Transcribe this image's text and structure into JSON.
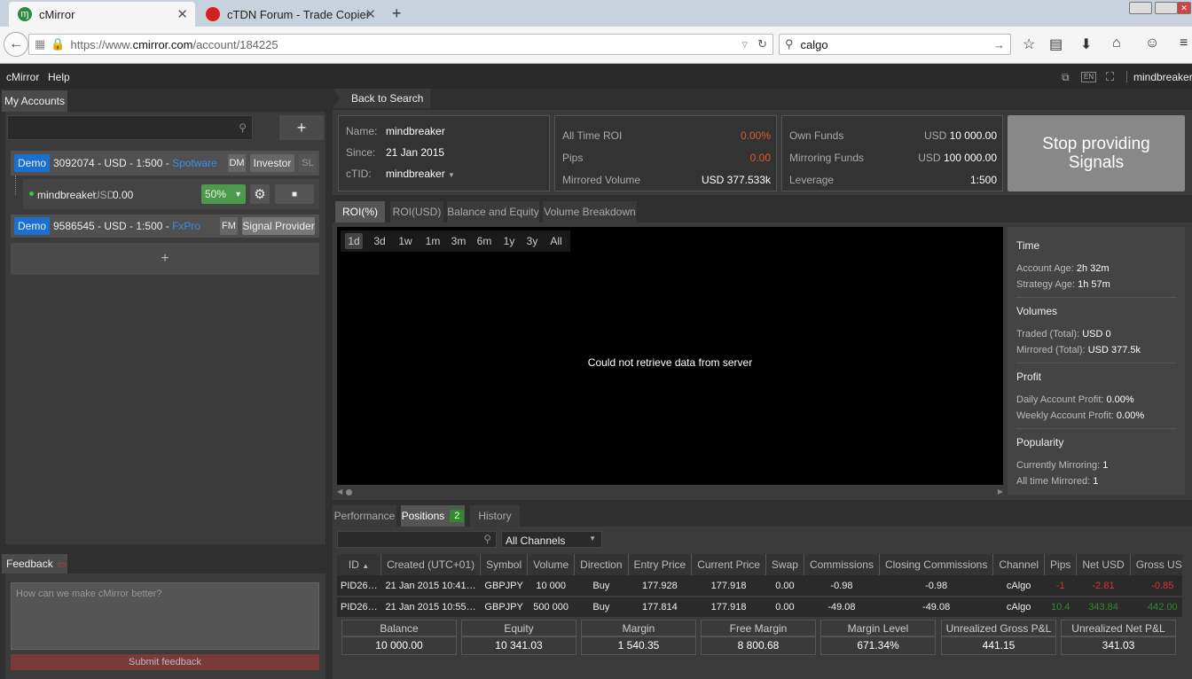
{
  "browser": {
    "tabs": [
      {
        "title": "cMirror",
        "active": true
      },
      {
        "title": "cTDN Forum - Trade Copier",
        "active": false
      }
    ],
    "url_prefix": "https://www.",
    "url_domain": "cmirror.com",
    "url_path": "/account/184225",
    "search_value": "calgo"
  },
  "app": {
    "menu": [
      "cMirror",
      "Help"
    ],
    "lang": "EN",
    "username": "mindbreaker",
    "colors": {
      "accent_blue": "#1a6fd1",
      "positive": "#2e8b2e",
      "negative": "#e03030",
      "green_btn": "#4c9a4c"
    }
  },
  "sidebar": {
    "tab": "My Accounts",
    "search_placeholder": "",
    "add_label": "+",
    "accounts": [
      {
        "badge": "Demo",
        "text": "3092074 - USD - 1:500 - ",
        "broker": "Spotware",
        "buttons": [
          "DM",
          "Investor",
          "SL"
        ]
      },
      {
        "badge": "Demo",
        "text": "9586545 - USD - 1:500 - ",
        "broker": "FxPro",
        "buttons": [
          "FM",
          "Signal Provider"
        ]
      }
    ],
    "sub_account": {
      "name": "mindbreaker",
      "currency": "USD",
      "value": "0.00",
      "percent": "50%"
    },
    "add_account_label": "+"
  },
  "feedback": {
    "tab": "Feedback",
    "placeholder": "How can we make cMirror better?",
    "submit": "Submit feedback"
  },
  "header": {
    "back": "Back to Search",
    "info": [
      {
        "label": "Name:",
        "value": "mindbreaker"
      },
      {
        "label": "Since:",
        "value": "21 Jan 2015"
      },
      {
        "label": "cTID:",
        "value": "mindbreaker"
      }
    ],
    "stats1": [
      {
        "label": "All Time ROI",
        "value": "0.00%",
        "color": "#e05a2b"
      },
      {
        "label": "Pips",
        "value": "0.00",
        "color": "#e05a2b"
      },
      {
        "label": "Mirrored Volume",
        "value": "USD 377.533k",
        "color": "#ffffff"
      }
    ],
    "stats2": [
      {
        "label": "Own Funds",
        "prefix": "USD ",
        "value": "10 000.00"
      },
      {
        "label": "Mirroring Funds",
        "prefix": "USD ",
        "value": "100 000.00"
      },
      {
        "label": "Leverage",
        "prefix": "",
        "value": "1:500"
      }
    ],
    "stop_button": "Stop providing Signals"
  },
  "chart_tabs": [
    "ROI(%)",
    "ROI(USD)",
    "Balance and Equity",
    "Volume Breakdown"
  ],
  "periods": [
    "1d",
    "3d",
    "1w",
    "1m",
    "3m",
    "6m",
    "1y",
    "3y",
    "All"
  ],
  "chart_message": "Could not retrieve data from server",
  "stats": [
    {
      "title": "Time",
      "lines": [
        {
          "k": "Account Age: ",
          "v": "2h 32m"
        },
        {
          "k": "Strategy Age: ",
          "v": "1h 57m"
        }
      ]
    },
    {
      "title": "Volumes",
      "lines": [
        {
          "k": "Traded (Total): ",
          "v": "USD 0"
        },
        {
          "k": "Mirrored (Total): ",
          "v": "USD 377.5k"
        }
      ]
    },
    {
      "title": "Profit",
      "lines": [
        {
          "k": "Daily Account Profit: ",
          "v": "0.00%"
        },
        {
          "k": "Weekly Account Profit: ",
          "v": "0.00%"
        }
      ]
    },
    {
      "title": "Popularity",
      "lines": [
        {
          "k": "Currently Mirroring: ",
          "v": "1"
        },
        {
          "k": "All time Mirrored: ",
          "v": "1"
        }
      ]
    }
  ],
  "bottom_tabs": [
    "Performance",
    "Positions",
    "History"
  ],
  "positions_count": "2",
  "channel_select": "All Channels",
  "table": {
    "headers": [
      "ID",
      "Created (UTC+01)",
      "Symbol",
      "Volume",
      "Direction",
      "Entry Price",
      "Current Price",
      "Swap",
      "Commissions",
      "Closing Commissions",
      "Channel",
      "Pips",
      "Net USD",
      "Gross USD"
    ],
    "rows": [
      [
        "PID26…",
        "21 Jan 2015 10:41…",
        "GBPJPY",
        "10 000",
        "Buy",
        "177.928",
        "177.918",
        "0.00",
        "-0.98",
        "-0.98",
        "cAlgo",
        "-1",
        "-2.81",
        "-0.85"
      ],
      [
        "PID26…",
        "21 Jan 2015 10:55…",
        "GBPJPY",
        "500 000",
        "Buy",
        "177.814",
        "177.918",
        "0.00",
        "-49.08",
        "-49.08",
        "cAlgo",
        "10.4",
        "343.84",
        "442.00"
      ]
    ]
  },
  "summary": [
    {
      "label": "Balance",
      "value": "10 000.00"
    },
    {
      "label": "Equity",
      "value": "10 341.03"
    },
    {
      "label": "Margin",
      "value": "1 540.35"
    },
    {
      "label": "Free Margin",
      "value": "8 800.68"
    },
    {
      "label": "Margin Level",
      "value": "671.34%"
    },
    {
      "label": "Unrealized Gross P&L",
      "value": "441.15"
    },
    {
      "label": "Unrealized Net P&L",
      "value": "341.03"
    }
  ]
}
